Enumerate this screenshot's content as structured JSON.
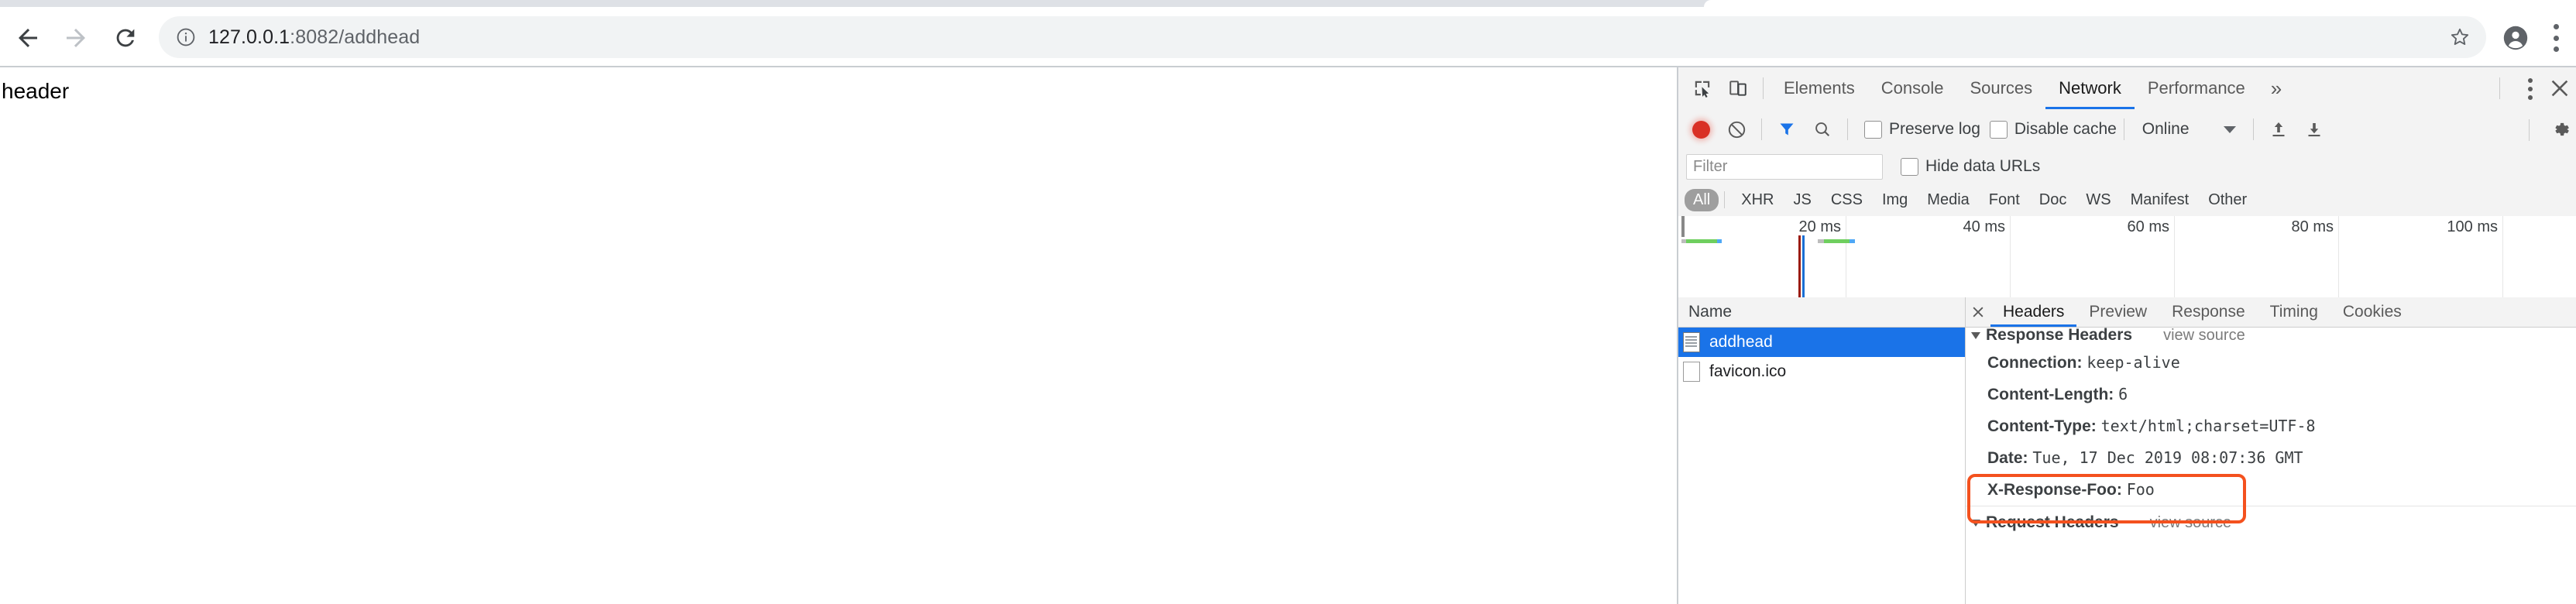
{
  "browser": {
    "nav": {
      "back": "back-arrow",
      "forward": "forward-arrow",
      "reload": "reload-arrow"
    },
    "omnibox": {
      "security_icon": "info-circle-icon",
      "url_host": "127.0.0.1",
      "url_rest": ":8082/addhead",
      "bookmark_icon": "star-icon"
    },
    "profile_icon": "profile-avatar-icon",
    "menu_icon": "three-dot-menu-icon"
  },
  "page": {
    "body_text": "header"
  },
  "devtools": {
    "inspect_icon": "inspect-element-icon",
    "device_icon": "device-toolbar-icon",
    "tabs": [
      {
        "label": "Elements",
        "selected": false
      },
      {
        "label": "Console",
        "selected": false
      },
      {
        "label": "Sources",
        "selected": false
      },
      {
        "label": "Network",
        "selected": true
      },
      {
        "label": "Performance",
        "selected": false
      }
    ],
    "more_tabs": "»",
    "kebab_icon": "devtools-more-options-icon",
    "close_icon": "devtools-close-icon",
    "network_toolbar": {
      "record_icon": "record-button-icon",
      "clear_icon": "clear-network-log-icon",
      "filter_icon": "filter-funnel-icon",
      "search_icon": "search-magnifier-icon",
      "preserve_log": {
        "label": "Preserve log",
        "checked": false
      },
      "disable_cache": {
        "label": "Disable cache",
        "checked": false
      },
      "throttling": "Online",
      "throttling_caret": "chevron-down-icon",
      "import_icon": "import-har-icon",
      "export_icon": "export-har-icon",
      "settings_icon": "network-settings-gear-icon"
    },
    "filter_row": {
      "placeholder": "Filter",
      "value": "",
      "hide_data_urls": {
        "label": "Hide data URLs",
        "checked": false
      }
    },
    "type_filters": [
      {
        "label": "All",
        "selected": true
      },
      {
        "label": "XHR",
        "selected": false
      },
      {
        "label": "JS",
        "selected": false
      },
      {
        "label": "CSS",
        "selected": false
      },
      {
        "label": "Img",
        "selected": false
      },
      {
        "label": "Media",
        "selected": false
      },
      {
        "label": "Font",
        "selected": false
      },
      {
        "label": "Doc",
        "selected": false
      },
      {
        "label": "WS",
        "selected": false
      },
      {
        "label": "Manifest",
        "selected": false
      },
      {
        "label": "Other",
        "selected": false
      }
    ],
    "overview": {
      "ticks": [
        "20 ms",
        "40 ms",
        "60 ms",
        "80 ms",
        "100 ms"
      ],
      "dom_content_loaded_color": "#9b1c12",
      "load_event_color": "#1a6fd4",
      "request_bar_colors": {
        "stalled": "#bdbdbd",
        "download": "#6fcf5f",
        "waiting": "#4fa8f5"
      }
    },
    "requests": {
      "column_header": "Name",
      "rows": [
        {
          "name": "addhead",
          "selected": true,
          "icon": "document-file-icon"
        },
        {
          "name": "favicon.ico",
          "selected": false,
          "icon": "blank-file-icon"
        }
      ]
    },
    "detail": {
      "close_icon": "close-detail-icon",
      "tabs": [
        {
          "label": "Headers",
          "selected": true
        },
        {
          "label": "Preview",
          "selected": false
        },
        {
          "label": "Response",
          "selected": false
        },
        {
          "label": "Timing",
          "selected": false
        },
        {
          "label": "Cookies",
          "selected": false
        }
      ],
      "response_headers": {
        "title": "Response Headers",
        "view_source": "view source",
        "expanded": true,
        "items": [
          {
            "key": "Connection:",
            "value": "keep-alive",
            "highlighted": false
          },
          {
            "key": "Content-Length:",
            "value": "6",
            "highlighted": false
          },
          {
            "key": "Content-Type:",
            "value": "text/html;charset=UTF-8",
            "highlighted": false
          },
          {
            "key": "Date:",
            "value": "Tue, 17 Dec 2019 08:07:36 GMT",
            "highlighted": false
          },
          {
            "key": "X-Response-Foo:",
            "value": "Foo",
            "highlighted": true
          }
        ]
      },
      "request_headers": {
        "title": "Request Headers",
        "view_source": "view source"
      },
      "highlight_color": "#f4511e"
    }
  }
}
